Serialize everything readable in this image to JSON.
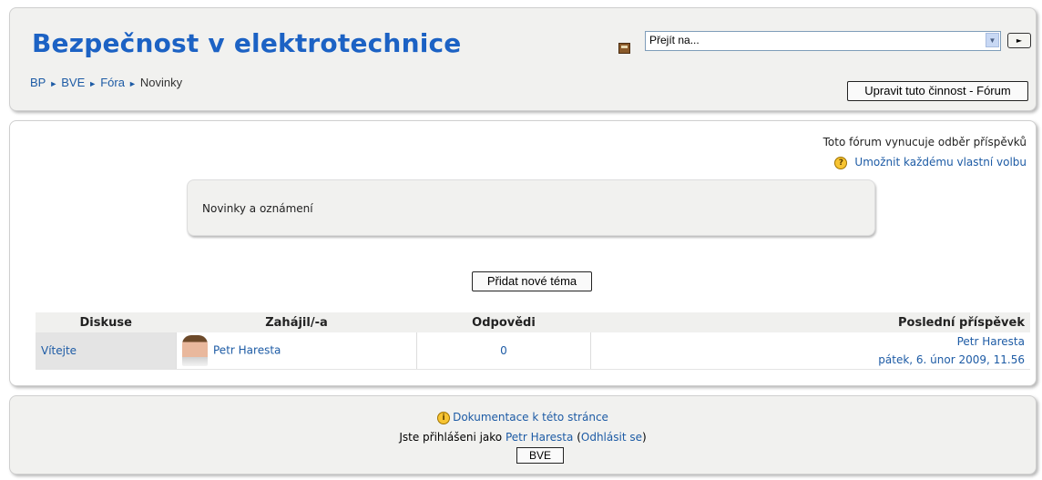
{
  "header": {
    "site_title": "Bezpečnost v elektrotechnice",
    "jump_select_value": "Přejít na...",
    "jump_go_label": "►",
    "breadcrumb": [
      {
        "label": "BP"
      },
      {
        "label": "BVE"
      },
      {
        "label": "Fóra"
      },
      {
        "label": "Novinky"
      }
    ],
    "breadcrumb_separator": "►",
    "edit_button_label": "Upravit tuto činnost - Fórum"
  },
  "forum": {
    "subscribe_notice": "Toto fórum vynucuje odběr příspěvků",
    "subscribe_link": "Umožnit každému vlastní volbu",
    "intro": "Novinky a oznámení",
    "add_topic_label": "Přidat nové téma",
    "table": {
      "headers": [
        "Diskuse",
        "Zahájil/-a",
        "Odpovědi",
        "Poslední příspěvek"
      ],
      "rows": [
        {
          "topic": "Vítejte",
          "author": "Petr Haresta",
          "replies": "0",
          "last_author": "Petr Haresta",
          "last_date": "pátek, 6. únor 2009, 11.56"
        }
      ]
    }
  },
  "footer": {
    "doc_link": "Dokumentace k této stránce",
    "logged_in_prefix": "Jste přihlášeni jako",
    "user_name": "Petr Haresta",
    "logout_open": "(",
    "logout_link": "Odhlásit se",
    "logout_close": ")",
    "course_button": "BVE"
  },
  "icons": {
    "help": "question-mark-circle",
    "info": "info-circle",
    "jump": "navigation-icon"
  },
  "colors": {
    "title": "#1c62c4",
    "link": "#1d5ba5",
    "panel": "#f1f1ef"
  }
}
